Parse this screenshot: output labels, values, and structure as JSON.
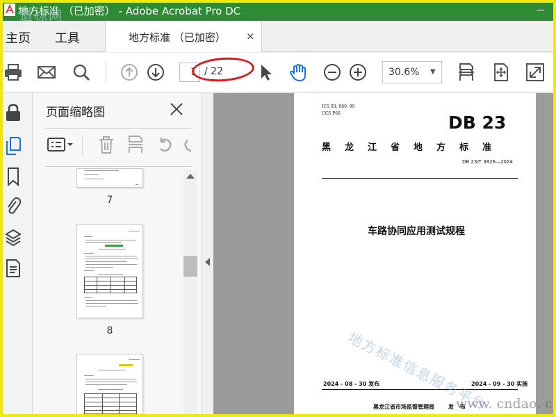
{
  "window": {
    "title": "地方标准 （已加密） - Adobe Acrobat Pro DC"
  },
  "tabs": {
    "home": "主页",
    "tools": "工具",
    "document": "地方标准 （已加密）",
    "close_symbol": "×"
  },
  "toolbar": {
    "icons": [
      "print-icon",
      "email-icon",
      "search-icon",
      "prev-page-icon",
      "next-page-icon",
      "select-cursor-icon",
      "hand-tool-icon",
      "zoom-out-icon",
      "zoom-in-icon",
      "fit-width-icon",
      "fit-page-icon",
      "fullscreen-icon"
    ],
    "current_page": "1",
    "total_pages": "/ 22",
    "zoom": "30.6%"
  },
  "colors": {
    "titlebar": "#2e8a34",
    "accent": "#1473e6",
    "annotation": "#d81c1c",
    "frame": "#f5e800"
  },
  "rail": {
    "icons": [
      "lock-icon",
      "page-thumbnails-icon",
      "bookmark-icon",
      "attachment-icon",
      "layers-icon",
      "page-content-icon"
    ]
  },
  "thumbnails_panel": {
    "title": "页面缩略图",
    "pages": [
      {
        "label": "7"
      },
      {
        "label": "8"
      }
    ]
  },
  "document": {
    "ics": "ICS  93. 080. 99",
    "ccs": "CCS  P66",
    "logo": "DB 23",
    "standard_type": "黑龙江省地方标准",
    "code": "DB 23/T  3826—2024",
    "title": "车路协同应用测试规程",
    "publish_date": "2024 - 08 - 30 发布",
    "implement_date": "2024 - 09 - 30 实施",
    "issuer": "黑龙江省市场监督管理局",
    "issue_label": "发 布"
  },
  "watermarks": {
    "diagonal": "地方标准信息服务平台",
    "site": "www. cndao. cc",
    "corner": "道标网"
  }
}
